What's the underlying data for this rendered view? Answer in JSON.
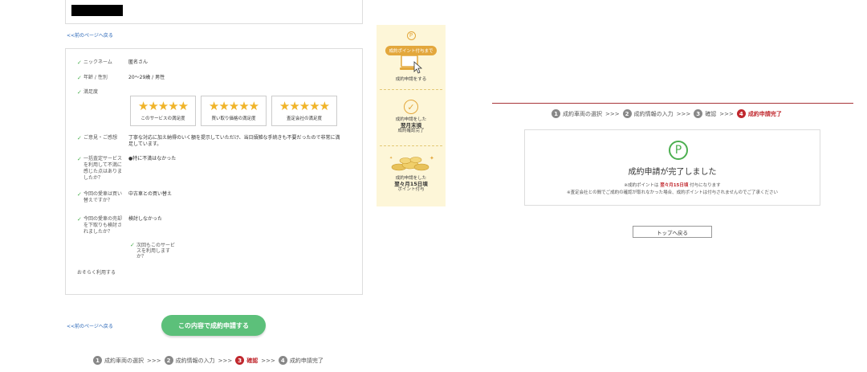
{
  "back_link": "<<前のページへ戻る",
  "form": {
    "rows": [
      {
        "label": "ニックネーム",
        "value": "匿名さん"
      },
      {
        "label": "年齢 / 性別",
        "value": "20〜29歳 / 男性"
      },
      {
        "label": "満足度",
        "value": ""
      },
      {
        "label": "ご意見・ご感想",
        "value": "丁寧な対応に加え納得のいく額を提示していただけ、当日煩雑な手続きも不要だったので非常に満足しています。"
      },
      {
        "label": "一括査定サービスを利用して不満に感じた点はありましたか？",
        "value": "●特に不満はなかった"
      },
      {
        "label": "今回の愛車は買い替えですか？",
        "value": "中古車との買い替え"
      },
      {
        "label": "今回の愛車の売却を下取りも検討されましたか？",
        "value": "検討しなかった"
      }
    ],
    "ratings": [
      {
        "stars": "★★★★★",
        "caption": "このサービスの満足度"
      },
      {
        "stars": "★★★★★",
        "caption": "買い取り価格の満足度"
      },
      {
        "stars": "★★★★★",
        "caption": "査定会社の満足度"
      }
    ],
    "sub_question": "次回もこのサービスを利用しますか？",
    "bottom_label": "おそらく利用する",
    "submit": "この内容で成約申請する"
  },
  "steps_left": [
    {
      "num": "1",
      "label": "成約車両の選択",
      "active": false
    },
    {
      "num": "2",
      "label": "成約情報の入力",
      "active": false
    },
    {
      "num": "3",
      "label": "確認",
      "active": true
    },
    {
      "num": "4",
      "label": "成約申請完了",
      "active": false
    }
  ],
  "steps_right": [
    {
      "num": "1",
      "label": "成約車両の選択",
      "active": false
    },
    {
      "num": "2",
      "label": "成約情報の入力",
      "active": false
    },
    {
      "num": "3",
      "label": "確認",
      "active": false
    },
    {
      "num": "4",
      "label": "成約申請完了",
      "active": true
    }
  ],
  "steps_sep": ">>>",
  "banner": {
    "p_letter": "P",
    "head": "成約ポイント付与まで",
    "step1": "成約申請をする",
    "step2_small": "成約申請をした",
    "step2_big": "翌月末頃",
    "step2_after": "成約確認完了",
    "step3_small": "成約申請をした",
    "step3_big": "翌々月15日頃",
    "step3_after": "ポイント付与"
  },
  "complete": {
    "p_letter": "P",
    "title": "成約申請が完了しました",
    "note1_pre": "※成約ポイントは",
    "note1_red": "翌々月15日頃",
    "note1_post": "付与になります",
    "note2": "※査定会社との間でご成約の確認が取れなかった場合、成約ポイントは付与されませんのでご了承ください",
    "top_button": "トップへ戻る"
  },
  "colors": {
    "accent_green": "#5cc07a",
    "accent_red": "#c0282e",
    "banner_bg": "#fdf6d8",
    "star": "#f0b429"
  }
}
